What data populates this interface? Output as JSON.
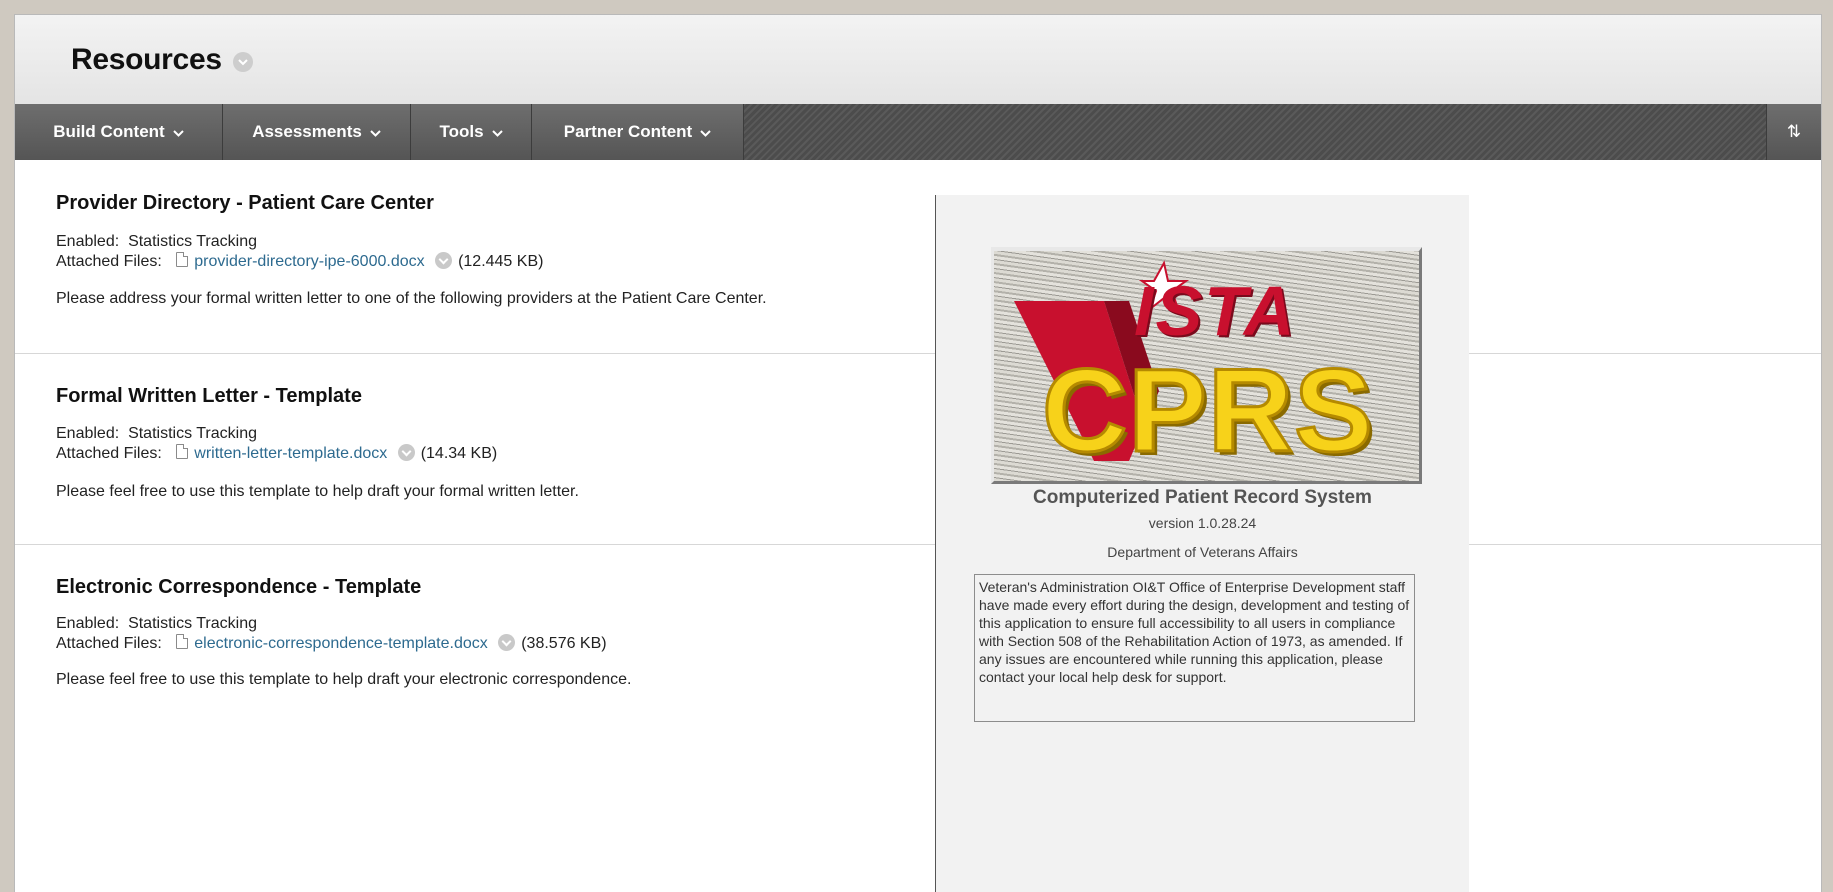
{
  "page": {
    "title": "Resources"
  },
  "toolbar": {
    "items": [
      {
        "label": "Build Content"
      },
      {
        "label": "Assessments"
      },
      {
        "label": "Tools"
      },
      {
        "label": "Partner Content"
      }
    ],
    "chevron": "⌄",
    "sort_icon": "sort-arrows-icon",
    "sort_glyph": "⇅"
  },
  "content_items": [
    {
      "title": "Provider Directory - Patient Care Center",
      "enabled_label": "Enabled:",
      "enabled_value": "Statistics Tracking",
      "attached_label": "Attached Files:",
      "file_name": "provider-directory-ipe-6000.docx",
      "file_size": "(12.445 KB)",
      "description": "Please address your formal written letter to one of the following providers at the Patient Care Center."
    },
    {
      "title": "Formal Written Letter - Template",
      "enabled_label": "Enabled:",
      "enabled_value": "Statistics Tracking",
      "attached_label": "Attached Files:",
      "file_name": "written-letter-template.docx",
      "file_size": "(14.34 KB)",
      "description": "Please feel free to use this template to help draft your formal written letter."
    },
    {
      "title": "Electronic Correspondence - Template",
      "enabled_label": "Enabled:",
      "enabled_value": "Statistics Tracking",
      "attached_label": "Attached Files:",
      "file_name": "electronic-correspondence-template.docx",
      "file_size": "(38.576 KB)",
      "description": "Please feel free to use this template to help draft your electronic correspondence."
    }
  ],
  "cprs": {
    "logo_text_top": "ISTA",
    "logo_text_main": "CPRS",
    "title": "Computerized Patient Record System",
    "version": "version 1.0.28.24",
    "department": "Department of Veterans Affairs",
    "notice": "Veteran's Administration OI&T Office of Enterprise Development staff have made every effort during the design, development and testing of this application to ensure full accessibility to all users in compliance with Section 508 of the Rehabilitation Action of 1973, as amended.  If any issues are encountered while running this application, please contact your local help desk for support."
  },
  "colors": {
    "link": "#2d6a8f",
    "toolbar": "#555555",
    "logo_red": "#c8102e",
    "logo_yellow": "#f7d21a"
  }
}
